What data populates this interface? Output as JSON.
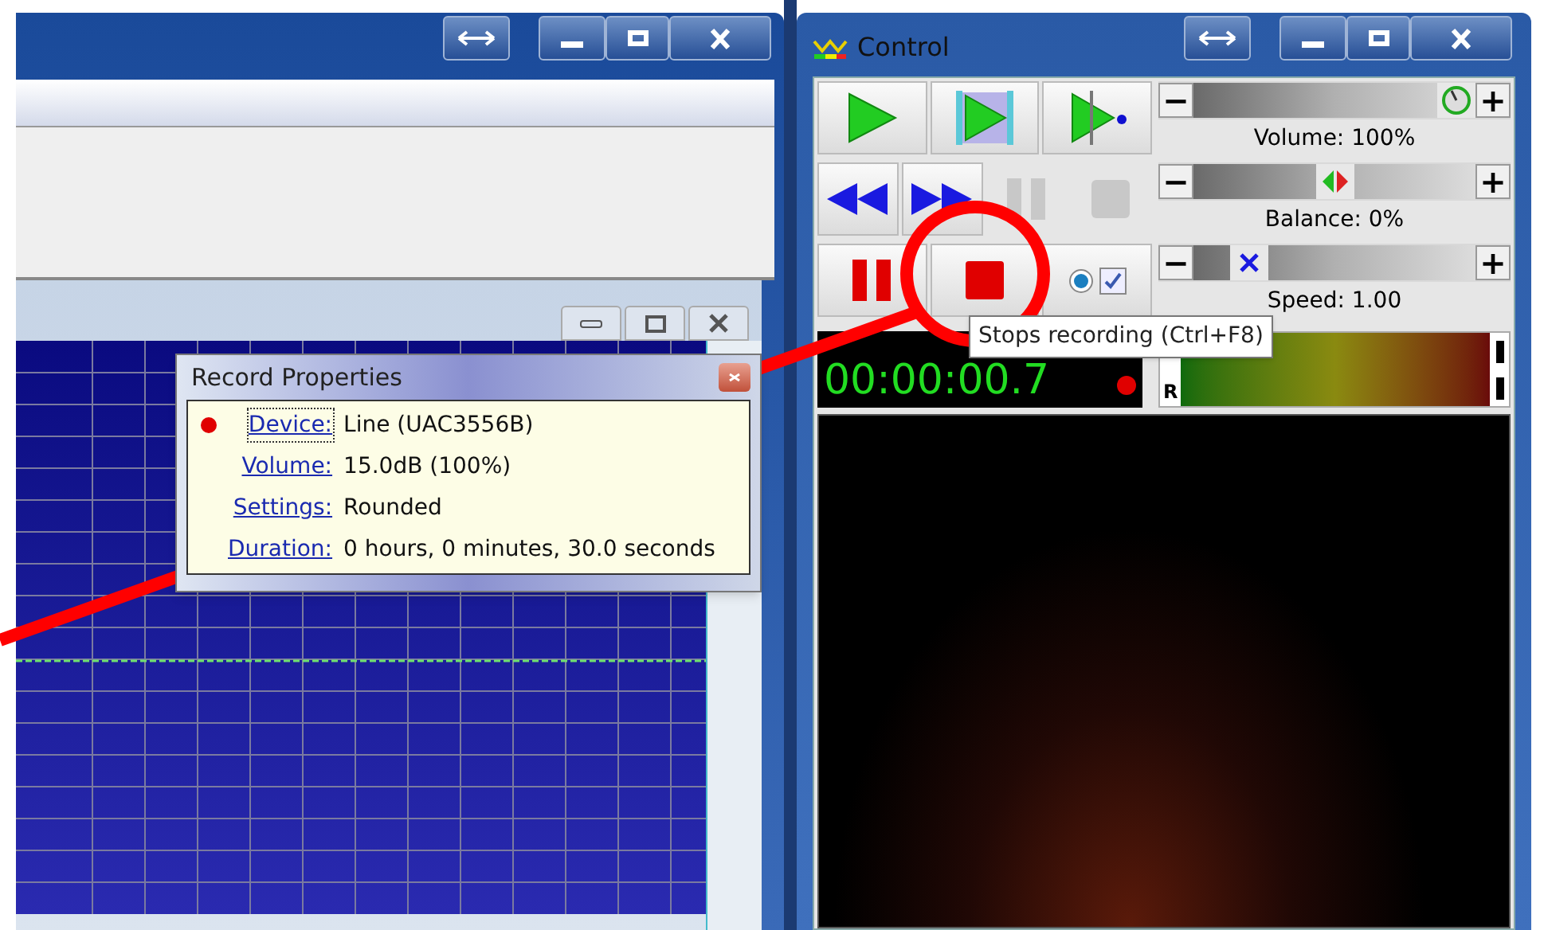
{
  "record_properties": {
    "title": "Record Properties",
    "rows": [
      {
        "label": "Device:",
        "value": "Line (UAC3556B)",
        "recording": true,
        "focused": true
      },
      {
        "label": "Volume:",
        "value": "15.0dB (100%)",
        "recording": false,
        "focused": false
      },
      {
        "label": "Settings:",
        "value": "Rounded",
        "recording": false,
        "focused": false
      },
      {
        "label": "Duration:",
        "value": "0 hours, 0 minutes, 30.0 seconds",
        "recording": false,
        "focused": false
      }
    ]
  },
  "control": {
    "title": "Control",
    "buttons": [
      {
        "kind": "play",
        "disabled": false
      },
      {
        "kind": "play-selection",
        "disabled": false
      },
      {
        "kind": "play-to-cursor",
        "disabled": false
      },
      {
        "kind": "rewind",
        "disabled": false
      },
      {
        "kind": "forward",
        "disabled": false
      },
      {
        "kind": "pause",
        "disabled": true
      },
      {
        "kind": "stop",
        "disabled": true
      },
      {
        "kind": "record-pause",
        "disabled": false
      },
      {
        "kind": "record-stop",
        "disabled": false
      }
    ],
    "monitor": {
      "selected": true,
      "checked": true
    },
    "sliders": [
      {
        "kind": "volume",
        "minus": "−",
        "plus": "+",
        "label": "Volume: 100%",
        "level": 1
      },
      {
        "kind": "balance",
        "minus": "−",
        "plus": "+",
        "label": "Balance: 0%",
        "level": 0.5
      },
      {
        "kind": "speed",
        "minus": "−",
        "plus": "+",
        "label": "Speed: 1.00",
        "level": 0.15
      }
    ],
    "timer": "00:00:00.7",
    "recording": true,
    "meter_channel": "R",
    "tooltip": "Stops recording (Ctrl+F8)"
  }
}
